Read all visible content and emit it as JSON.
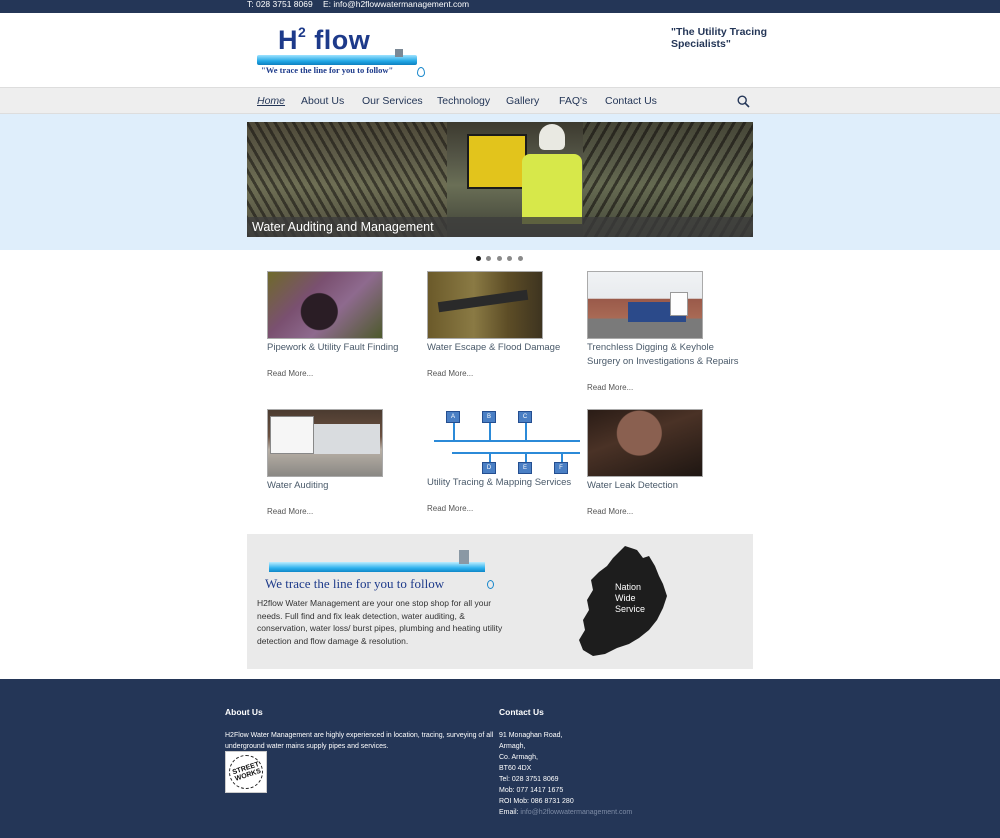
{
  "topbar": {
    "phone": "T: 028 3751 8069",
    "email": "E: info@h2flowwatermanagement.com"
  },
  "header": {
    "logo_text": "H² flow",
    "logo_tagline": "\"We trace the line for you to follow\"",
    "slogan": "\"The Utility Tracing Specialists\""
  },
  "nav": {
    "items": [
      {
        "label": "Home",
        "active": true
      },
      {
        "label": "About Us"
      },
      {
        "label": "Our Services"
      },
      {
        "label": "Technology"
      },
      {
        "label": "Gallery"
      },
      {
        "label": "FAQ's"
      },
      {
        "label": "Contact Us"
      }
    ],
    "search_icon": "search-icon"
  },
  "slider": {
    "caption": "Water Auditing and Management",
    "slide_count": 5,
    "current": 1
  },
  "services": [
    {
      "title": "Pipework & Utility Fault Finding",
      "more": "Read More..."
    },
    {
      "title": "Water Escape & Flood Damage",
      "more": "Read More..."
    },
    {
      "title": "Trenchless Digging & Keyhole Surgery on Investigations & Repairs",
      "more": "Read More..."
    },
    {
      "title": "Water Auditing",
      "more": "Read More..."
    },
    {
      "title": "Utility Tracing & Mapping Services",
      "more": "Read More..."
    },
    {
      "title": "Water Leak Detection",
      "more": "Read More..."
    }
  ],
  "promo": {
    "tagline": "We  trace the line for you to follow",
    "text": "H2flow Water Management are your one stop shop for all your needs. Full find and fix leak detection, water auditing, & conservation, water loss/ burst pipes, plumbing and heating utility detection and flow damage & resolution.",
    "map_label": "Nation Wide Service"
  },
  "footer": {
    "about": {
      "heading": "About Us",
      "text": "H2Flow Water Management are highly experienced in location, tracing, surveying of all underground water mains supply pipes and services.",
      "badge": "STREET WORKS"
    },
    "contact": {
      "heading": "Contact Us",
      "lines": [
        "91 Monaghan Road,",
        "Armagh,",
        "Co. Armagh,",
        "BT60 4DX",
        "Tel: 028 3751 8069",
        "Mob: 077 1417 1675",
        "ROI Mob: 086 8731 280"
      ],
      "email_label": "Email:",
      "email": "info@h2flowwatermanagement.com"
    }
  },
  "colors": {
    "navy": "#243657",
    "hero_band": "#dfeefb",
    "nav_bg": "#eeeeee",
    "promo_bg": "#eaeaea"
  }
}
